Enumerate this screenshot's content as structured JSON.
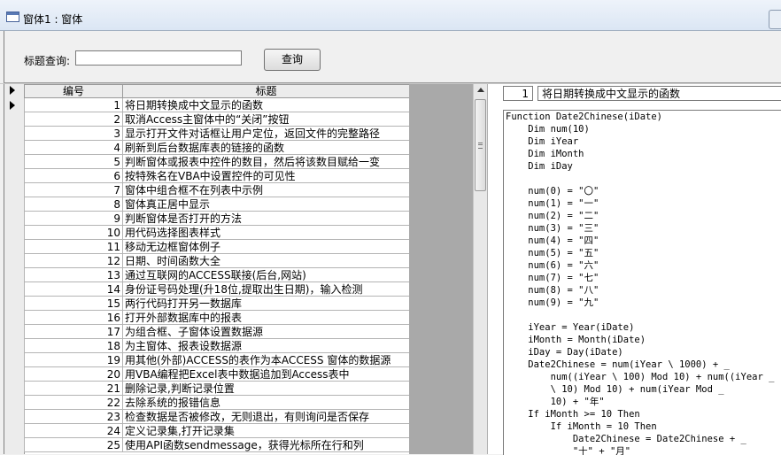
{
  "window": {
    "title": "窗体1 : 窗体"
  },
  "search": {
    "label": "标题查询:",
    "value": "",
    "button_label": "查询"
  },
  "grid": {
    "columns": [
      "编号",
      "标题"
    ],
    "rows": [
      {
        "id": "1",
        "title": "将日期转换成中文显示的函数"
      },
      {
        "id": "2",
        "title": "取消Access主窗体中的“关闭”按钮"
      },
      {
        "id": "3",
        "title": "显示打开文件对话框让用户定位，返回文件的完整路径"
      },
      {
        "id": "4",
        "title": "刷新到后台数据库表的链接的函数"
      },
      {
        "id": "5",
        "title": "判断窗体或报表中控件的数目，然后将该数目赋给一变"
      },
      {
        "id": "6",
        "title": "按特殊名在VBA中设置控件的可见性"
      },
      {
        "id": "7",
        "title": "窗体中组合框不在列表中示例"
      },
      {
        "id": "8",
        "title": "窗体真正居中显示"
      },
      {
        "id": "9",
        "title": "判断窗体是否打开的方法"
      },
      {
        "id": "10",
        "title": "用代码选择图表样式"
      },
      {
        "id": "11",
        "title": "移动无边框窗体例子"
      },
      {
        "id": "12",
        "title": "日期、时间函数大全"
      },
      {
        "id": "13",
        "title": "通过互联网的ACCESS联接(后台,网站)"
      },
      {
        "id": "14",
        "title": "身份证号码处理(升18位,提取出生日期)，输入检测"
      },
      {
        "id": "15",
        "title": "两行代码打开另一数据库"
      },
      {
        "id": "16",
        "title": "打开外部数据库中的报表"
      },
      {
        "id": "17",
        "title": "为组合框、子窗体设置数据源"
      },
      {
        "id": "18",
        "title": "为主窗体、报表设数据源"
      },
      {
        "id": "19",
        "title": "用其他(外部)ACCESS的表作为本ACCESS 窗体的数据源"
      },
      {
        "id": "20",
        "title": "用VBA编程把Excel表中数据追加到Access表中"
      },
      {
        "id": "21",
        "title": "删除记录,判断记录位置"
      },
      {
        "id": "22",
        "title": "去除系统的报错信息"
      },
      {
        "id": "23",
        "title": "检查数据是否被修改，无则退出，有则询问是否保存"
      },
      {
        "id": "24",
        "title": "定义记录集,打开记录集"
      },
      {
        "id": "25",
        "title": "使用API函数sendmessage，获得光标所在行和列"
      }
    ]
  },
  "detail": {
    "id": "1",
    "title": "将日期转换成中文显示的函数",
    "code_lines": [
      "Function Date2Chinese(iDate)",
      "    Dim num(10)",
      "    Dim iYear",
      "    Dim iMonth",
      "    Dim iDay",
      "",
      "    num(0) = \"〇\"",
      "    num(1) = \"一\"",
      "    num(2) = \"二\"",
      "    num(3) = \"三\"",
      "    num(4) = \"四\"",
      "    num(5) = \"五\"",
      "    num(6) = \"六\"",
      "    num(7) = \"七\"",
      "    num(8) = \"八\"",
      "    num(9) = \"九\"",
      "",
      "    iYear = Year(iDate)",
      "    iMonth = Month(iDate)",
      "    iDay = Day(iDate)",
      "    Date2Chinese = num(iYear \\ 1000) + _",
      "        num((iYear \\ 100) Mod 10) + num((iYear _",
      "        \\ 10) Mod 10) + num(iYear Mod _",
      "        10) + \"年\"",
      "    If iMonth >= 10 Then",
      "        If iMonth = 10 Then",
      "            Date2Chinese = Date2Chinese + _",
      "            \"十\" + \"月\""
    ]
  }
}
